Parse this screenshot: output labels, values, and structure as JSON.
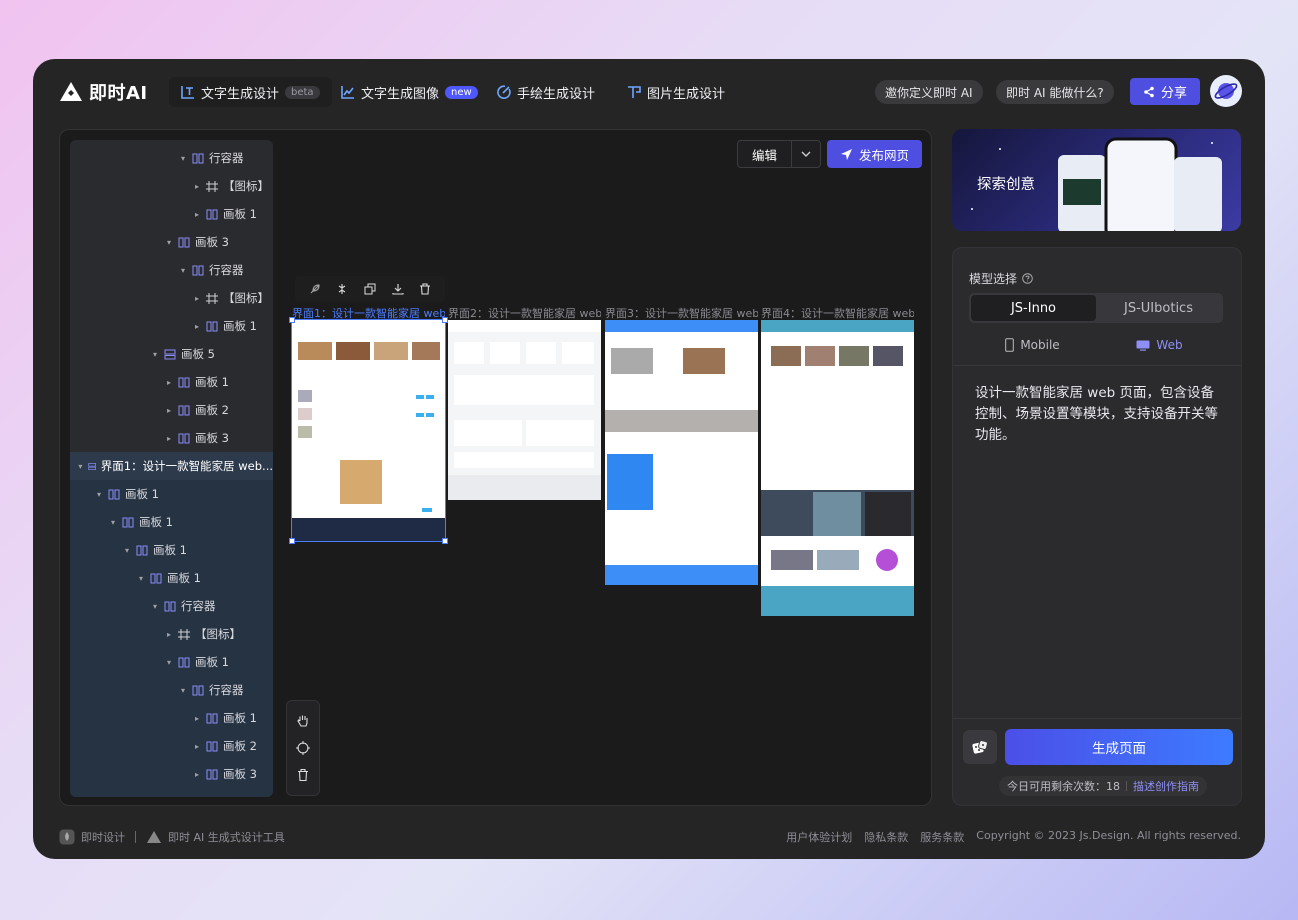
{
  "app": {
    "logo_text": "即时AI",
    "tabs": [
      {
        "label": "文字生成设计",
        "badge": "beta"
      },
      {
        "label": "文字生成图像",
        "badge": "new"
      },
      {
        "label": "手绘生成设计",
        "badge": ""
      },
      {
        "label": "图片生成设计",
        "badge": ""
      }
    ],
    "pills": [
      "邀你定义即时 AI",
      "即时 AI 能做什么?"
    ],
    "share_label": "分享"
  },
  "colors": {
    "accent": "#4e4fe0",
    "link": "#8e8ff6",
    "selection": "#4c7dff"
  },
  "layers": [
    {
      "label": "行容器",
      "icon": "column-icon"
    },
    {
      "label": "【图标】",
      "icon": "frame-icon"
    },
    {
      "label": "画板 1",
      "icon": "column-icon"
    },
    {
      "label": "画板 3",
      "icon": "column-icon"
    },
    {
      "label": "行容器",
      "icon": "column-icon"
    },
    {
      "label": "【图标】",
      "icon": "frame-icon"
    },
    {
      "label": "画板 1",
      "icon": "column-icon"
    },
    {
      "label": "画板 5",
      "icon": "row-icon"
    },
    {
      "label": "画板 1",
      "icon": "column-icon"
    },
    {
      "label": "画板 2",
      "icon": "column-icon"
    },
    {
      "label": "画板 3",
      "icon": "column-icon"
    },
    {
      "label": "界面1：设计一款智能家居 web...",
      "icon": "row-icon"
    },
    {
      "label": "画板 1",
      "icon": "column-icon"
    },
    {
      "label": "画板 1",
      "icon": "column-icon"
    },
    {
      "label": "画板 1",
      "icon": "column-icon"
    },
    {
      "label": "画板 1",
      "icon": "column-icon"
    },
    {
      "label": "行容器",
      "icon": "column-icon"
    },
    {
      "label": "【图标】",
      "icon": "frame-icon"
    },
    {
      "label": "画板 1",
      "icon": "column-icon"
    },
    {
      "label": "行容器",
      "icon": "column-icon"
    },
    {
      "label": "画板 1",
      "icon": "column-icon"
    },
    {
      "label": "画板 2",
      "icon": "column-icon"
    },
    {
      "label": "画板 3",
      "icon": "column-icon"
    }
  ],
  "canvas": {
    "edit_label": "编辑",
    "publish_label": "发布网页",
    "frames": [
      {
        "label": "界面1：设计一款智能家居 web…"
      },
      {
        "label": "界面2：设计一款智能家居 web…"
      },
      {
        "label": "界面3：设计一款智能家居 web…"
      },
      {
        "label": "界面4：设计一款智能家居 web…"
      }
    ]
  },
  "right": {
    "banner_title": "探索创意",
    "model_label": "模型选择",
    "models": [
      "JS-Inno",
      "JS-UIbotics"
    ],
    "devices": [
      "Mobile",
      "Web"
    ],
    "prompt": "设计一款智能家居 web 页面，包含设备控制、场景设置等模块，支持设备开关等功能。",
    "generate_label": "生成页面",
    "quota_text": "今日可用剩余次数：18",
    "guide_link": "描述创作指南"
  },
  "footer": {
    "left": [
      "即时设计",
      "即时 AI 生成式设计工具"
    ],
    "links": [
      "用户体验计划",
      "隐私条款",
      "服务条款"
    ],
    "copyright": "Copyright © 2023 Js.Design. All rights reserved."
  }
}
